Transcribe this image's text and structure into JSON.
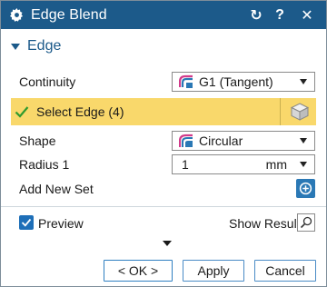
{
  "window": {
    "title": "Edge Blend",
    "reset_glyph": "↻",
    "help_glyph": "?",
    "close_glyph": "✕"
  },
  "section": {
    "label": "Edge"
  },
  "continuity": {
    "label": "Continuity",
    "value": "G1 (Tangent)",
    "icon": "tangent-continuity-icon"
  },
  "select_edge": {
    "label": "Select Edge (4)",
    "icon": "cube-select-icon"
  },
  "shape": {
    "label": "Shape",
    "value": "Circular",
    "icon": "circular-shape-icon"
  },
  "radius": {
    "label": "Radius 1",
    "value": "1",
    "unit": "mm"
  },
  "add_set": {
    "label": "Add New Set",
    "icon": "plus-circle-icon"
  },
  "preview": {
    "label": "Preview",
    "checked": true
  },
  "show_result": {
    "label": "Show Result",
    "icon": "magnifier-icon"
  },
  "buttons": {
    "ok": "< OK >",
    "apply": "Apply",
    "cancel": "Cancel"
  },
  "colors": {
    "titlebar": "#1c5a8a",
    "highlight": "#f9d86b",
    "accent": "#1e6fb8"
  }
}
